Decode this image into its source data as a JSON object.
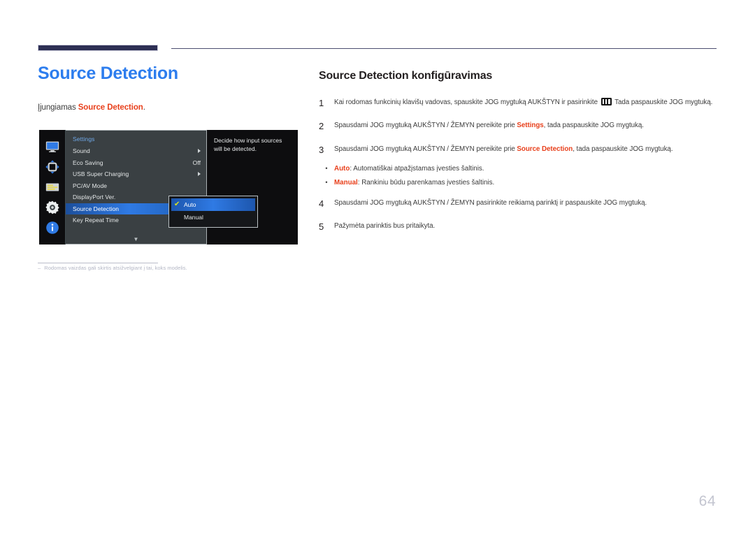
{
  "document": {
    "title": "Source Detection",
    "lead_prefix": "Įjungiamas ",
    "lead_bold": "Source Detection",
    "lead_suffix": ".",
    "page_number": "64",
    "footnote_dash": "‒",
    "footnote": "Rodomas vaizdas gali skirtis atsižvelgiant į tai, koks modelis."
  },
  "osd": {
    "rail_icons": [
      "monitor-icon",
      "picture-adjust-icon",
      "onscreen-display-icon",
      "system-gear-icon",
      "information-icon"
    ],
    "menu_header": "Settings",
    "rows": [
      {
        "label": "Sound",
        "value": "",
        "arrow": true,
        "selected": false
      },
      {
        "label": "Eco Saving",
        "value": "Off",
        "arrow": false,
        "selected": false
      },
      {
        "label": "USB Super Charging",
        "value": "",
        "arrow": true,
        "selected": false
      },
      {
        "label": "PC/AV Mode",
        "value": "",
        "arrow": false,
        "selected": false
      },
      {
        "label": "DisplayPort Ver.",
        "value": "",
        "arrow": false,
        "selected": false
      },
      {
        "label": "Source Detection",
        "value": "",
        "arrow": false,
        "selected": true
      },
      {
        "label": "Key Repeat Time",
        "value": "",
        "arrow": false,
        "selected": false
      }
    ],
    "scroll_down_glyph": "▼",
    "description": "Decide how input sources will be detected.",
    "popup": {
      "options": [
        {
          "label": "Auto",
          "checked": true,
          "check_glyph": "✔"
        },
        {
          "label": "Manual",
          "checked": false,
          "check_glyph": "✔"
        }
      ]
    }
  },
  "instructions": {
    "heading": "Source Detection konfigūravimas",
    "steps": [
      {
        "num": "1",
        "text_before": "Kai rodomas funkcinių klavišų vadovas, spauskite JOG mygtuką AUKŠTYN ir pasirinkite ",
        "has_icon": true,
        "text_after": " Tada paspauskite JOG mygtuką."
      },
      {
        "num": "2",
        "text_before": "Spausdami JOG mygtuką AUKŠTYN / ŽEMYN pereikite prie ",
        "bold": "Settings",
        "text_after": ", tada paspauskite JOG mygtuką."
      },
      {
        "num": "3",
        "text_before": "Spausdami JOG mygtuką AUKŠTYN / ŽEMYN pereikite prie ",
        "bold": "Source Detection",
        "text_after": ", tada paspauskite JOG mygtuką."
      }
    ],
    "bullet_glyph": "•",
    "bullets": [
      {
        "bold": "Auto",
        "text": ": Automatiškai atpažįstamas įvesties šaltinis."
      },
      {
        "bold": "Manual",
        "text": ": Rankiniu būdu parenkamas įvesties šaltinis."
      }
    ],
    "steps_after": [
      {
        "num": "4",
        "text": "Spausdami JOG mygtuką AUKŠTYN / ŽEMYN pasirinkite reikiamą parinktį ir paspauskite JOG mygtuką."
      },
      {
        "num": "5",
        "text": "Pažymėta parinktis bus pritaikyta."
      }
    ]
  },
  "colors": {
    "title_blue": "#2d7dee",
    "accent_red": "#e8401c",
    "rule_navy": "#2e3054",
    "osd_select_blue": "#2f7ae4",
    "page_number_gray": "#c3c5d0"
  }
}
